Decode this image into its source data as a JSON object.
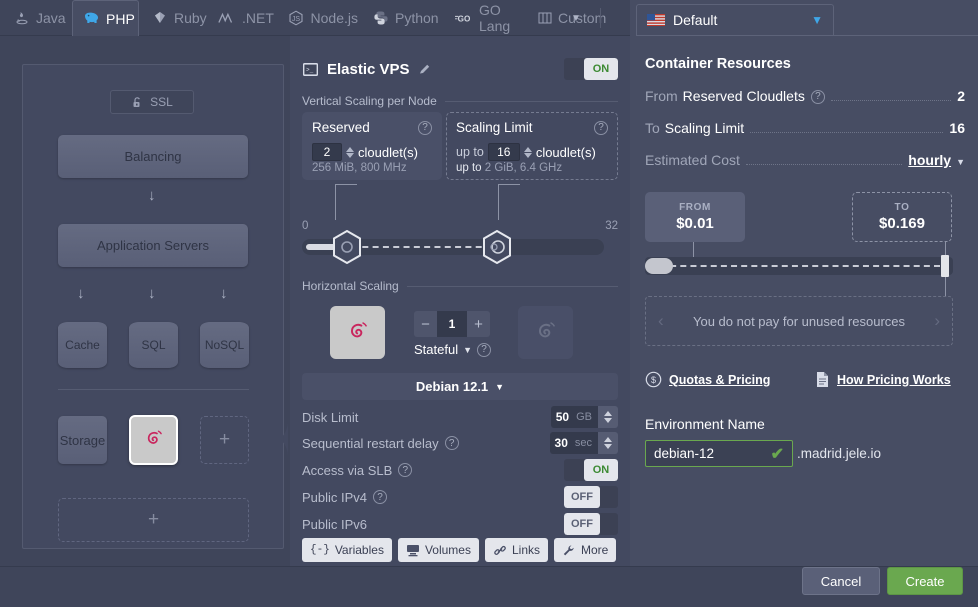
{
  "tabs": [
    {
      "label": "Java",
      "icon": "java-icon",
      "active": false
    },
    {
      "label": "PHP",
      "icon": "php-elephant-icon",
      "active": true
    },
    {
      "label": "Ruby",
      "icon": "ruby-gem-icon",
      "active": false
    },
    {
      "label": ".NET",
      "icon": "dotnet-icon",
      "active": false
    },
    {
      "label": "Node.js",
      "icon": "nodejs-icon",
      "active": false
    },
    {
      "label": "Python",
      "icon": "python-icon",
      "active": false
    },
    {
      "label": "GO Lang",
      "icon": "golang-icon",
      "active": false
    },
    {
      "label": "Custom",
      "icon": "custom-columns-icon",
      "active": false
    }
  ],
  "tabbar": {
    "more_caret": "▼",
    "close": "✕"
  },
  "topology": {
    "ssl_label": "SSL",
    "balancing": "Balancing",
    "app_servers": "Application Servers",
    "databases": [
      "Cache",
      "SQL",
      "NoSQL"
    ],
    "storage": "Storage",
    "selected_node_icon": "debian-logo-icon",
    "add_node": "+",
    "add_layer": "+"
  },
  "middle": {
    "title": "Elastic VPS",
    "title_icon": "terminal-icon",
    "edit_icon": "pencil-icon",
    "power_toggle": "ON",
    "vertical_section": "Vertical Scaling per Node",
    "reserved": {
      "title": "Reserved",
      "value": "2",
      "unit": "cloudlet(s)",
      "detail": "256 MiB, 800 MHz"
    },
    "scaling_limit": {
      "title": "Scaling Limit",
      "prefix": "up to",
      "value": "16",
      "unit": "cloudlet(s)",
      "detail_prefix": "up to",
      "detail": "2 GiB, 6.4 GHz"
    },
    "slider": {
      "min": "0",
      "max": "32"
    },
    "horizontal_section": "Horizontal Scaling",
    "node_count": {
      "minus": "−",
      "value": "1",
      "plus": "+"
    },
    "stateful_label": "Stateful",
    "os_name": "Debian 12.1",
    "disk_limit": {
      "label": "Disk Limit",
      "value": "50",
      "unit": "GB"
    },
    "restart_delay": {
      "label": "Sequential restart delay",
      "value": "30",
      "unit": "sec"
    },
    "access_slb": {
      "label": "Access via SLB",
      "state": "ON"
    },
    "public_ipv4": {
      "label": "Public IPv4",
      "state": "OFF"
    },
    "public_ipv6": {
      "label": "Public IPv6",
      "state": "OFF"
    },
    "buttons": [
      {
        "label": "Variables",
        "icon": "braces-icon"
      },
      {
        "label": "Volumes",
        "icon": "volumes-icon"
      },
      {
        "label": "Links",
        "icon": "link-icon"
      },
      {
        "label": "More",
        "icon": "wrench-icon"
      }
    ]
  },
  "right": {
    "region_tab": "Default",
    "region_flag_icon": "us-flag-icon",
    "region_caret": "▼",
    "heading": "Container Resources",
    "rows": [
      {
        "prefix": "From",
        "label": "Reserved Cloudlets",
        "help": true,
        "value": "2"
      },
      {
        "prefix": "To",
        "label": "Scaling Limit",
        "help": false,
        "value": "16"
      }
    ],
    "estimated_cost_label": "Estimated Cost",
    "period": "hourly",
    "period_caret": "▼",
    "price_from": {
      "caption": "FROM",
      "amount": "$0.01"
    },
    "price_to": {
      "caption": "TO",
      "amount": "$0.169"
    },
    "unused_note": "You do not pay for unused resources",
    "nav_prev": "‹",
    "nav_next": "›",
    "links": [
      {
        "label": "Quotas & Pricing",
        "icon": "dollar-circle-icon"
      },
      {
        "label": "How Pricing Works",
        "icon": "document-icon"
      }
    ],
    "env_name_label": "Environment Name",
    "env_name_value": "debian-12",
    "env_valid_icon": "✔",
    "env_domain": ".madrid.jele.io"
  },
  "footer": {
    "cancel": "Cancel",
    "create": "Create"
  },
  "colors": {
    "accent_green": "#6aa84f",
    "panel": "#434960",
    "panel_right": "#474d63",
    "window": "#3f455a",
    "text": "#d8dce8",
    "debian_red": "#c9265e"
  }
}
